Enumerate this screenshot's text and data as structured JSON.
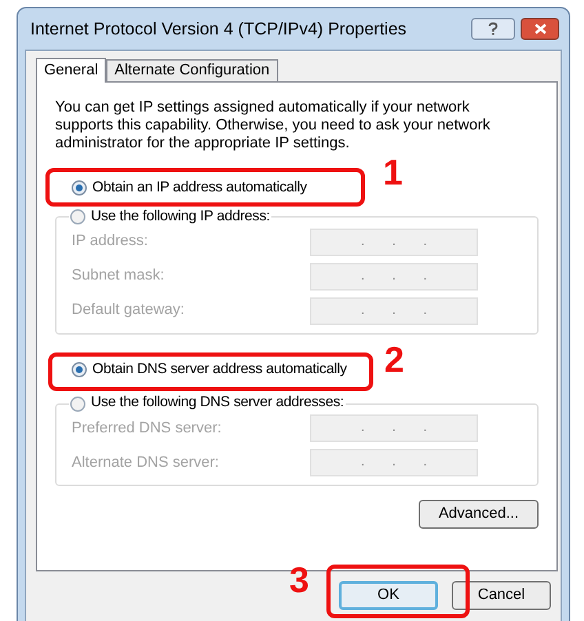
{
  "window": {
    "title": "Internet Protocol Version 4 (TCP/IPv4) Properties"
  },
  "tabs": [
    {
      "label": "General",
      "selected": true
    },
    {
      "label": "Alternate Configuration",
      "selected": false
    }
  ],
  "description": "You can get IP settings assigned automatically if your network supports this capability. Otherwise, you need to ask your network administrator for the appropriate IP settings.",
  "ip_section": {
    "auto_option": {
      "label": "Obtain an IP address automatically",
      "selected": true
    },
    "manual_option": {
      "label": "Use the following IP address:",
      "selected": false
    },
    "disabled": true,
    "fields": [
      {
        "label": "IP address:",
        "separators": [
          ".",
          ".",
          "."
        ]
      },
      {
        "label": "Subnet mask:",
        "separators": [
          ".",
          ".",
          "."
        ]
      },
      {
        "label": "Default gateway:",
        "separators": [
          ".",
          ".",
          "."
        ]
      }
    ]
  },
  "dns_section": {
    "auto_option": {
      "label": "Obtain DNS server address automatically",
      "selected": true
    },
    "manual_option": {
      "label": "Use the following DNS server addresses:",
      "selected": false
    },
    "disabled": true,
    "fields": [
      {
        "label": "Preferred DNS server:",
        "separators": [
          ".",
          ".",
          "."
        ]
      },
      {
        "label": "Alternate DNS server:",
        "separators": [
          ".",
          ".",
          "."
        ]
      }
    ]
  },
  "advanced_button": "Advanced...",
  "buttons": [
    {
      "label": "OK",
      "default": true
    },
    {
      "label": "Cancel",
      "default": false
    }
  ],
  "annotations": [
    {
      "number": "1"
    },
    {
      "number": "2"
    },
    {
      "number": "3"
    }
  ]
}
